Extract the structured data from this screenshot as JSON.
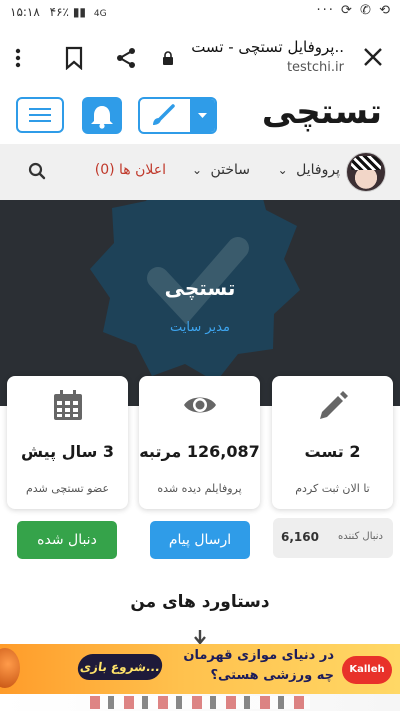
{
  "status_bar": {
    "time": "۱۵:۱۸",
    "battery": "۴۶٪",
    "network": "4G"
  },
  "browser": {
    "title": "پروفایل تستچی - تست..",
    "url": "testchi.ir"
  },
  "site": {
    "logo": "تستچی"
  },
  "nav": {
    "profile": "پروفایل",
    "build": "ساختن",
    "ads": "اعلان ها (0)"
  },
  "profile": {
    "name": "تستچی",
    "role": "مدیر سایت"
  },
  "stats": [
    {
      "value": "2 تست",
      "label": "تا الان ثبت کردم",
      "icon": "pencil-icon"
    },
    {
      "value": "126,087 مرتبه",
      "label": "پروفایلم دیده شده",
      "icon": "eye-icon"
    },
    {
      "value": "3 سال پیش",
      "label": "عضو تستچی شدم",
      "icon": "calendar-icon"
    }
  ],
  "actions": {
    "following": "دنبال شده",
    "message": "ارسال پیام"
  },
  "followers": {
    "count": "6,160",
    "label": "دنبال کننده"
  },
  "achievements": {
    "title": "دستاورد های من"
  },
  "ad": {
    "line1": "در دنیای موازی قهرمان",
    "line2": "چه ورزشی هستی؟",
    "cta": "شروع بازی...",
    "brand": "Kalleh"
  },
  "colors": {
    "primary": "#2f9ce8",
    "success": "#35a34a",
    "hero_bg": "#2b2f34",
    "alert": "#c0392b"
  }
}
